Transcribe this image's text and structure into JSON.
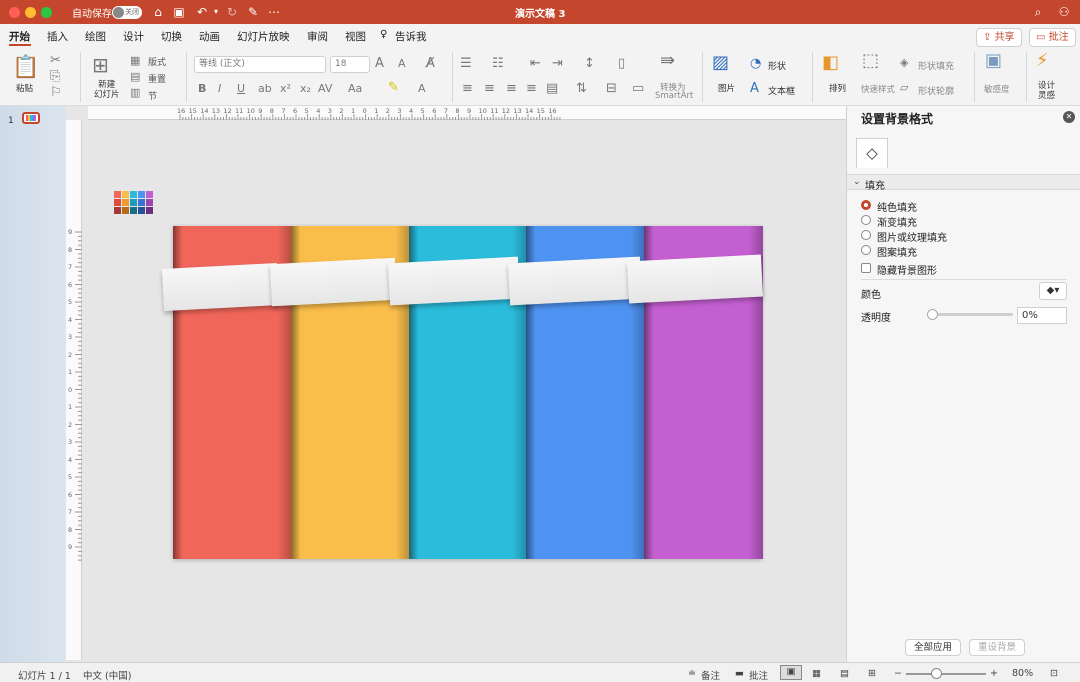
{
  "titlebar": {
    "autosave_label": "自动保存",
    "autosave_state": "关闭",
    "doc_title": "演示文稿 3"
  },
  "tabs": [
    "开始",
    "插入",
    "绘图",
    "设计",
    "切换",
    "动画",
    "幻灯片放映",
    "审阅",
    "视图",
    "告诉我"
  ],
  "actions": {
    "share": "共享",
    "comment": "批注"
  },
  "ribbon": {
    "paste": "粘贴",
    "new_slide": "新建\n幻灯片",
    "layout": "版式",
    "reset": "重置",
    "section": "节",
    "font_name": "等线 (正文)",
    "font_size": "18",
    "convert_smartart_1": "转换为",
    "convert_smartart_2": "SmartArt",
    "picture": "图片",
    "shape": "形状",
    "textbox": "文本框",
    "arrange": "排列",
    "quick_styles": "快速样式",
    "shape_fill": "形状填充",
    "shape_outline": "形状轮廓",
    "sensitivity": "敏感度",
    "designer": "设计\n灵感"
  },
  "ruler": {
    "h_ticks": [
      "16",
      "15",
      "14",
      "13",
      "12",
      "11",
      "10",
      "9",
      "8",
      "7",
      "6",
      "5",
      "4",
      "3",
      "2",
      "1",
      "0",
      "1",
      "2",
      "3",
      "4",
      "5",
      "6",
      "7",
      "8",
      "9",
      "10",
      "11",
      "12",
      "13",
      "14",
      "15",
      "16"
    ],
    "v_ticks": [
      "9",
      "8",
      "7",
      "6",
      "5",
      "4",
      "3",
      "2",
      "1",
      "0",
      "1",
      "2",
      "3",
      "4",
      "5",
      "6",
      "7",
      "8",
      "9"
    ]
  },
  "thumbnails": {
    "number": "1"
  },
  "slide": {
    "stripes": [
      "#f1665a",
      "#f9bd4a",
      "#2bbcdc",
      "#4f93f2",
      "#c45fd2"
    ]
  },
  "format_pane": {
    "title": "设置背景格式",
    "section": "填充",
    "options": [
      "纯色填充",
      "渐变填充",
      "图片或纹理填充",
      "图案填充"
    ],
    "selected_option": "纯色填充",
    "hide_bg": "隐藏背景图形",
    "color_label": "颜色",
    "transparency_label": "透明度",
    "transparency_value": "0%",
    "apply_all": "全部应用",
    "reset_bg": "重设背景"
  },
  "statusbar": {
    "slide_info": "幻灯片 1 / 1",
    "language": "中文 (中国)",
    "notes": "备注",
    "comments": "批注",
    "zoom": "80%"
  }
}
